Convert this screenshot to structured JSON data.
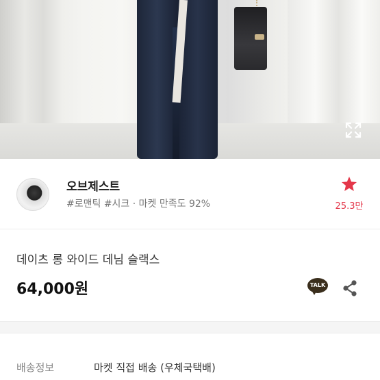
{
  "seller": {
    "name": "오브제스트",
    "tags": "#로맨틱 #시크 · 마켓 만족도 92%",
    "favorite_count": "25.3만"
  },
  "product": {
    "title": "데이츠 롱 와이드 데님 슬랙스",
    "price": "64,000원"
  },
  "actions": {
    "talk_label": "TALK"
  },
  "shipping": {
    "label": "배송정보",
    "value": "마켓 직접 배송 (우체국택배)"
  },
  "colors": {
    "favorite_accent": "#e4374a",
    "talk_bubble": "#3a2e1c"
  },
  "icons": {
    "expand": "expand-icon",
    "favorite": "star-icon",
    "talk": "kakaotalk-icon",
    "share": "share-icon"
  }
}
